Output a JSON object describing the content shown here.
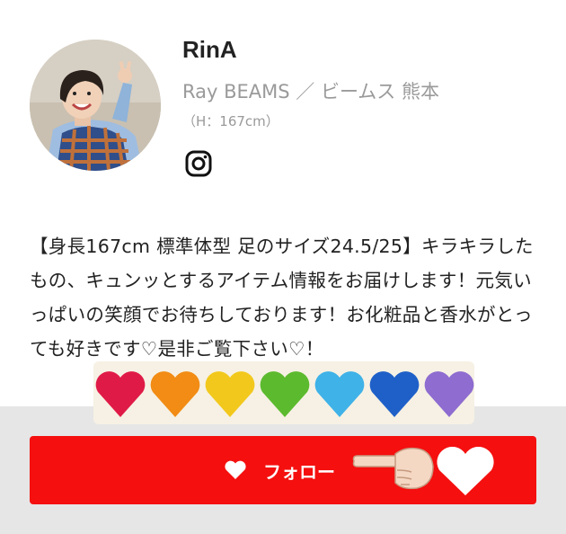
{
  "profile": {
    "name": "RinA",
    "shop": "Ray BEAMS ／ ビームス 熊本",
    "height": "（H：167cm）"
  },
  "bio": "【身長167cm 標準体型 足のサイズ24.5/25】キラキラしたもの、キュンッとするアイテム情報をお届けします！元気いっぱいの笑顔でお待ちしております！お化粧品と香水がとっても好きです♡是非ご覧下さい♡！",
  "icons": {
    "social": "instagram-icon",
    "follow": "heart-icon",
    "decorations": [
      "pointing-hand-icon",
      "heart-icon"
    ]
  },
  "hearts": [
    "#e01a47",
    "#f28c14",
    "#f2c81c",
    "#5cba2e",
    "#3fb2e8",
    "#1f60c8",
    "#8e6cd0"
  ],
  "follow_button": {
    "label": "フォロー",
    "color": "#f50f0f"
  }
}
